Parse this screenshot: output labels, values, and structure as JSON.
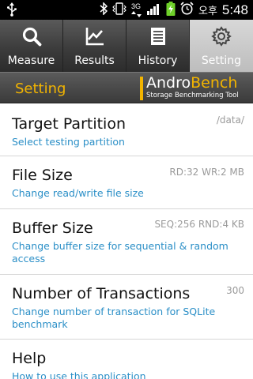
{
  "status_bar": {
    "usb_icon": "usb-icon",
    "network_type": "3G",
    "clock_prefix": "오후",
    "time": "5:48"
  },
  "tabs": [
    {
      "label": "Measure",
      "icon": "magnifier-icon"
    },
    {
      "label": "Results",
      "icon": "chart-icon"
    },
    {
      "label": "History",
      "icon": "document-icon"
    },
    {
      "label": "Setting",
      "icon": "gear-icon"
    }
  ],
  "header": {
    "title": "Setting",
    "logo_name_a": "Andro",
    "logo_name_b": "Bench",
    "logo_tagline": "Storage Benchmarking Tool",
    "accent_color": "#f2b400"
  },
  "settings": [
    {
      "title": "Target Partition",
      "summary": "Select testing partition",
      "value": "/data/"
    },
    {
      "title": "File Size",
      "summary": "Change read/write file size",
      "value": "RD:32  WR:2 MB"
    },
    {
      "title": "Buffer Size",
      "summary": "Change buffer size for sequential & random access",
      "value": "SEQ:256  RND:4 KB"
    },
    {
      "title": "Number of Transactions",
      "summary": "Change number of transaction for SQLite benchmark",
      "value": "300"
    },
    {
      "title": "Help",
      "summary": "How to use this application",
      "value": ""
    }
  ]
}
